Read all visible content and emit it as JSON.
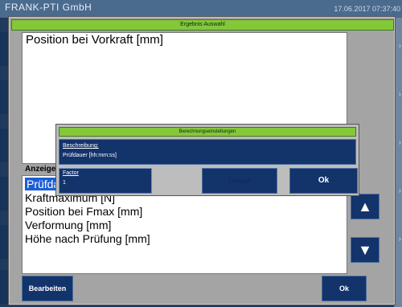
{
  "window": {
    "company": "FRANK-PTI GmbH",
    "clock": "17.06.2017 07:37:40"
  },
  "dialog": {
    "title": "Ergebnis Auswahl",
    "top_panel_text": "Position bei Vorkraft [mm]",
    "anzeige_label": "Anzeige",
    "list_items": [
      "Prüfdauer [hh:mm:ss]",
      "Kraftmaximum [N]",
      "Position bei Fmax [mm]",
      "Verformung [mm]",
      "Höhe nach Prüfung [mm]"
    ],
    "selected_index": 0,
    "up_label": "▲",
    "down_label": "▼",
    "edit_button": "Bearbeiten",
    "ok_button": "Ok"
  },
  "settings_dialog": {
    "title": "Berechnungseinstellungen",
    "description_label": "Beschreibung:",
    "description_value": "Prüfdauer [hh:mm:ss]",
    "factor_label": "Factor",
    "factor_value": "1",
    "default_button": "Default",
    "ok_button": "Ok"
  },
  "colors": {
    "title_green": "#84c83a",
    "button_navy": "#13336b",
    "selection_blue": "#1c5dd6",
    "dialog_gray": "#a4a4a4"
  }
}
